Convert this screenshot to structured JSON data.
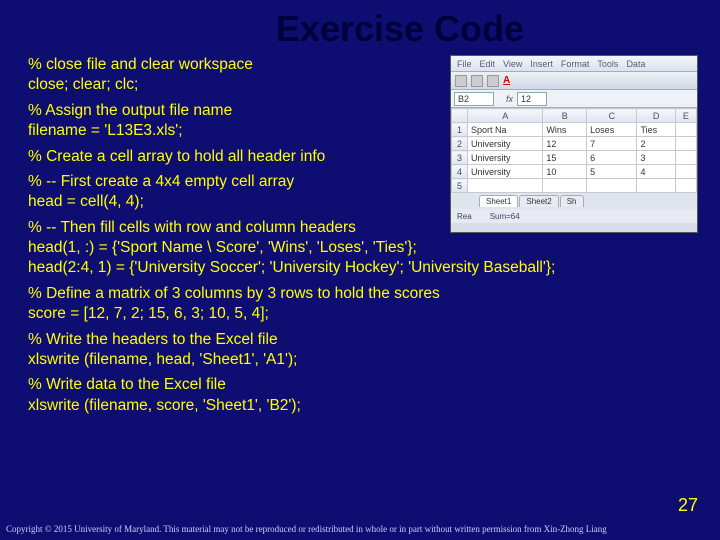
{
  "title": "Exercise Code",
  "code": {
    "l1": "% close file and clear workspace",
    "l2": "close; clear; clc;",
    "l3": "% Assign the output file name",
    "l4": "filename = 'L13E3.xls';",
    "l5": "% Create a cell array to hold all header info",
    "l6": "% -- First create a 4x4 empty cell array",
    "l7": "head = cell(4, 4);",
    "l8": "% -- Then fill cells with row and column headers",
    "l9": "head(1, :) = {'Sport Name \\ Score', 'Wins', 'Loses', 'Ties'};",
    "l10": "head(2:4, 1) = {'University Soccer'; 'University Hockey'; 'University Baseball'};",
    "l11": "% Define a matrix of 3 columns by 3 rows to hold the scores",
    "l12": "score = [12, 7, 2; 15, 6, 3; 10, 5, 4];",
    "l13": "% Write the headers to the Excel file",
    "l14": "xlswrite (filename, head, 'Sheet1', 'A1');",
    "l15": "% Write data to the Excel file",
    "l16": "xlswrite (filename, score, 'Sheet1', 'B2');"
  },
  "excel": {
    "menu": {
      "m1": "File",
      "m2": "Edit",
      "m3": "View",
      "m4": "Insert",
      "m5": "Format",
      "m6": "Tools",
      "m7": "Data"
    },
    "namebox": "B2",
    "fx_value": "12",
    "cols": {
      "a": "A",
      "b": "B",
      "c": "C",
      "d": "D",
      "e": "E"
    },
    "rows": {
      "r1": {
        "h": "1",
        "a": "Sport Na",
        "b": "Wins",
        "c": "Loses",
        "d": "Ties"
      },
      "r2": {
        "h": "2",
        "a": "University",
        "b": "12",
        "c": "7",
        "d": "2"
      },
      "r3": {
        "h": "3",
        "a": "University",
        "b": "15",
        "c": "6",
        "d": "3"
      },
      "r4": {
        "h": "4",
        "a": "University",
        "b": "10",
        "c": "5",
        "d": "4"
      },
      "r5": {
        "h": "5"
      }
    },
    "tabs": {
      "t1": "Sheet1",
      "t2": "Sheet2",
      "t3": "Sh"
    },
    "status": {
      "s1": "Rea",
      "s2": "Sum=64"
    }
  },
  "page_number": "27",
  "copyright": "Copyright © 2015 University of Maryland. This material may not be reproduced or redistributed in whole or in part without written permission from Xin-Zhong Liang"
}
